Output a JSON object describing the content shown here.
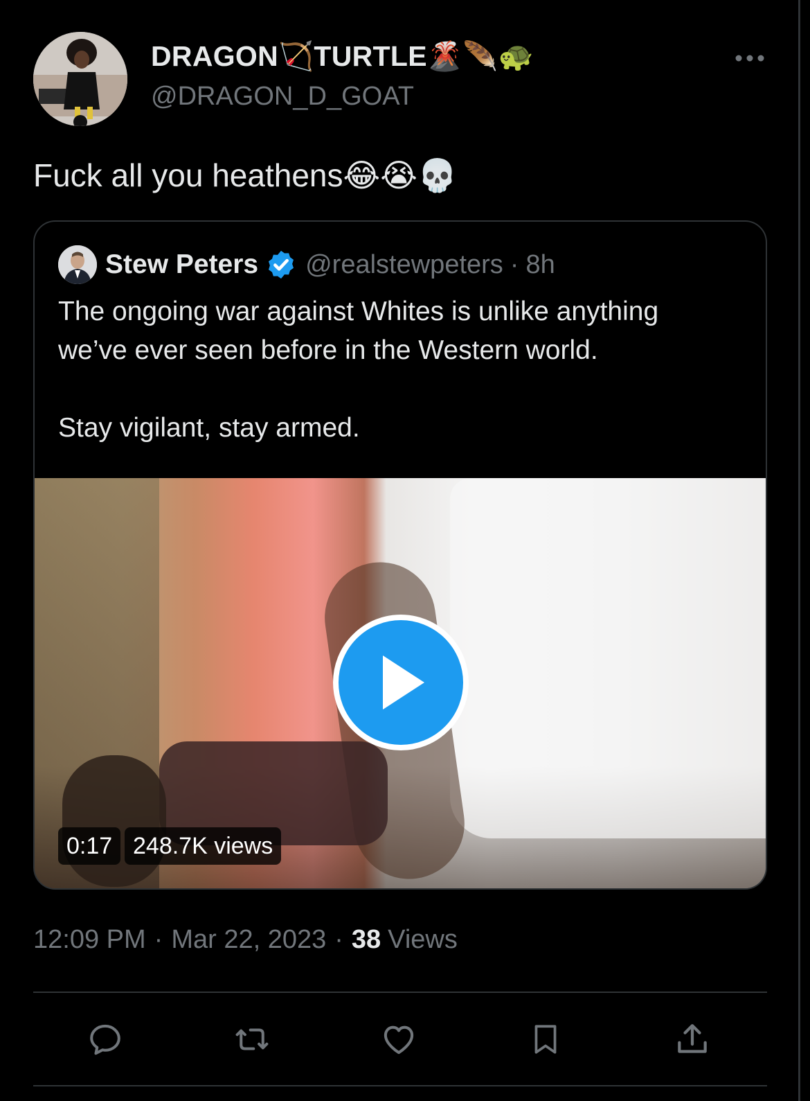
{
  "tweet": {
    "author": {
      "display_name": "DRAGON🏹TURTLE🌋🪶🐢",
      "handle": "@DRAGON_D_GOAT"
    },
    "text": "Fuck all you heathens😂😭💀",
    "quoted": {
      "name": "Stew Peters",
      "verified": true,
      "handle": "@realstewpeters",
      "separator": "·",
      "time": "8h",
      "lines": [
        "The ongoing war against Whites is unlike anything",
        "we’ve ever seen before in the Western world.",
        "Stay vigilant, stay armed."
      ],
      "video": {
        "duration": "0:17",
        "views": "248.7K views"
      }
    },
    "meta": {
      "time": "12:09 PM",
      "separator": "·",
      "date": "Mar 22, 2023",
      "view_count": "38",
      "views_label": "Views"
    },
    "actions": [
      "reply-icon",
      "retweet-icon",
      "like-icon",
      "bookmark-icon",
      "share-icon"
    ]
  },
  "colors": {
    "background": "#000000",
    "text": "#e7e9ea",
    "muted": "#71767b",
    "border": "#2f3336",
    "accent": "#1d9bf0"
  }
}
